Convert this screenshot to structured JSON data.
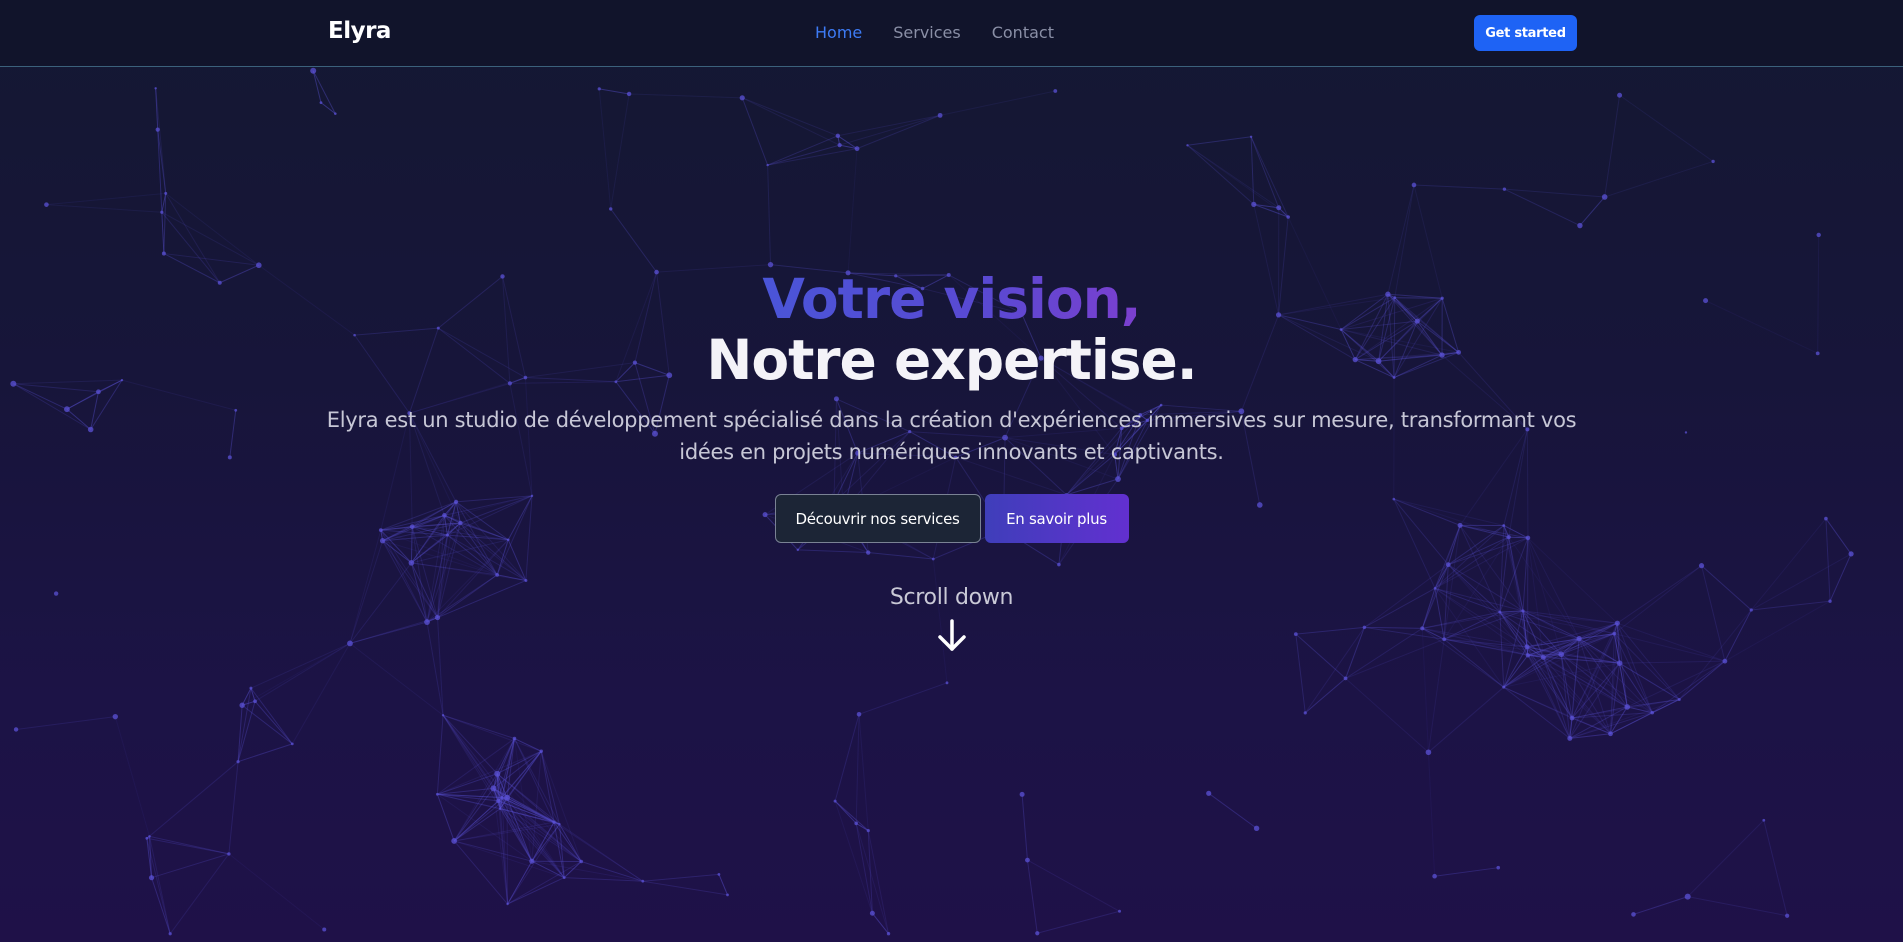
{
  "nav": {
    "brand": "Elyra",
    "links": [
      {
        "label": "Home",
        "active": true
      },
      {
        "label": "Services",
        "active": false
      },
      {
        "label": "Contact",
        "active": false
      }
    ],
    "cta_label": "Get started"
  },
  "hero": {
    "title_line1": "Votre vision,",
    "title_line2": "Notre expertise.",
    "description": "Elyra est un studio de développement spécialisé dans la création d'expériences immersives sur mesure, transformant vos idées en projets numériques innovants et captivants.",
    "primary_button": "En savoir plus",
    "secondary_button": "Découvrir nos services",
    "scroll_label": "Scroll down"
  },
  "colors": {
    "accent": "#1e63f5",
    "nav_active": "#3d7bf5",
    "title_gradient_start": "#4a55d8",
    "title_gradient_end": "#7c3fcf",
    "network_lines": "#5b52d6"
  },
  "icons": {
    "scroll": "arrow-down-icon"
  }
}
